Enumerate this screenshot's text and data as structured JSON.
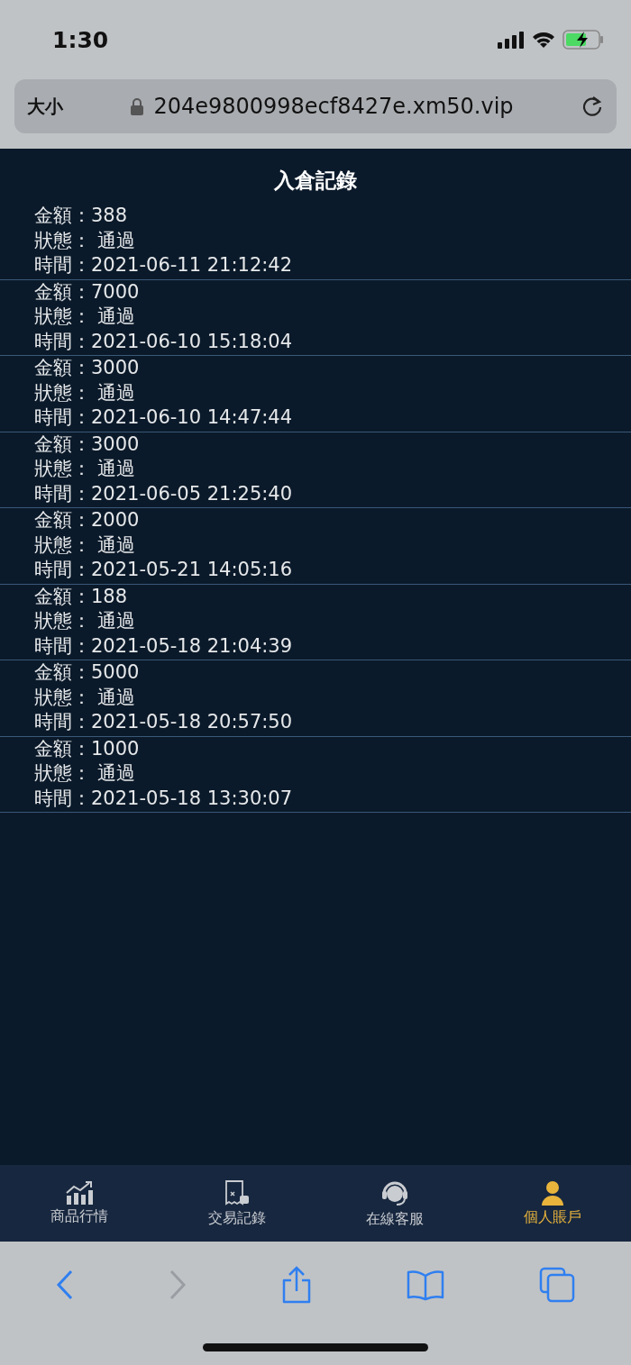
{
  "status_bar": {
    "time": "1:30"
  },
  "address_bar": {
    "text_size": "大小",
    "url": "204e9800998ecf8427e.xm50.vip"
  },
  "page": {
    "title": "入倉記錄",
    "records": [
      {
        "amount": "金額：388",
        "status": "狀態： 通過",
        "time": "時間：2021-06-11 21:12:42"
      },
      {
        "amount": "金額：7000",
        "status": "狀態： 通過",
        "time": "時間：2021-06-10 15:18:04"
      },
      {
        "amount": "金額：3000",
        "status": "狀態： 通過",
        "time": "時間：2021-06-10 14:47:44"
      },
      {
        "amount": "金額：3000",
        "status": "狀態： 通過",
        "time": "時間：2021-06-05 21:25:40"
      },
      {
        "amount": "金額：2000",
        "status": "狀態： 通過",
        "time": "時間：2021-05-21 14:05:16"
      },
      {
        "amount": "金額：188",
        "status": "狀態： 通過",
        "time": "時間：2021-05-18 21:04:39"
      },
      {
        "amount": "金額：5000",
        "status": "狀態： 通過",
        "time": "時間：2021-05-18 20:57:50"
      },
      {
        "amount": "金額：1000",
        "status": "狀態： 通過",
        "time": "時間：2021-05-18 13:30:07"
      }
    ]
  },
  "tab_bar": [
    {
      "kind": "chart",
      "label": "商品行情",
      "selected": false
    },
    {
      "kind": "receipt",
      "label": "交易記錄",
      "selected": false
    },
    {
      "kind": "headset",
      "label": "在線客服",
      "selected": false
    },
    {
      "kind": "person",
      "label": "個人賬戶",
      "selected": true
    }
  ],
  "browser_toolbar": {
    "back_disabled": false,
    "forward_disabled": true
  }
}
